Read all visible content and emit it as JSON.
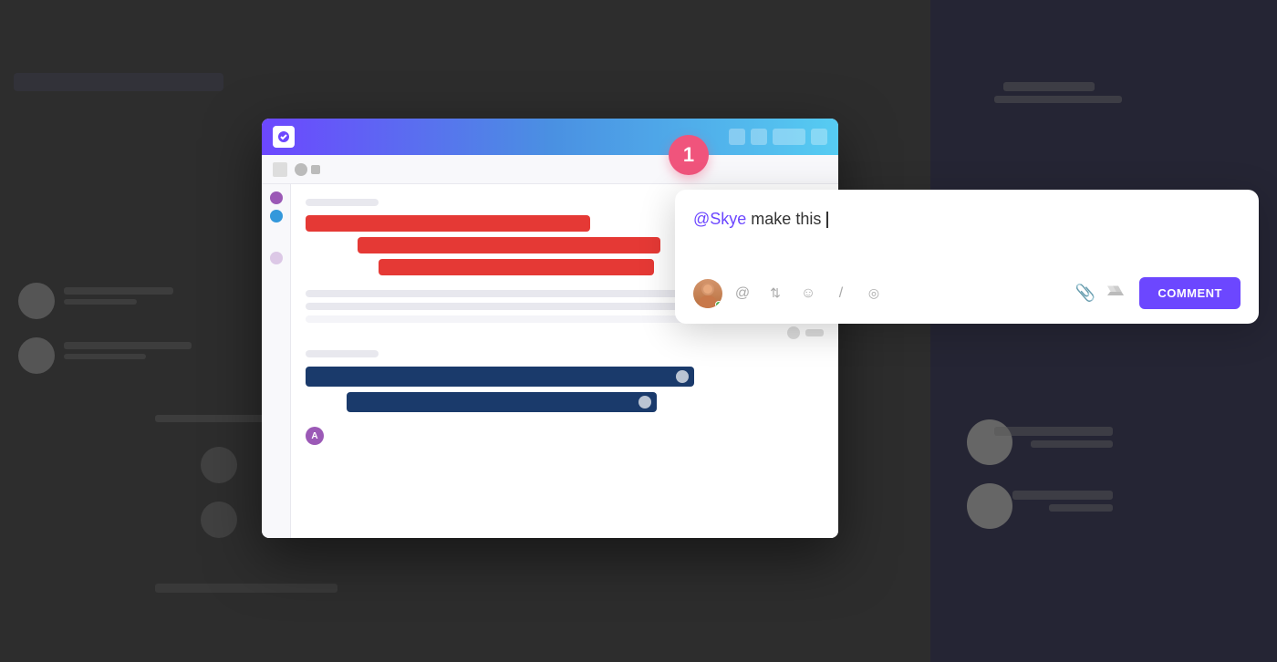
{
  "background": {
    "color": "#2d2d2d"
  },
  "badge": {
    "number": "1",
    "color": "#f0547c"
  },
  "comment_popup": {
    "mention": "@Skye",
    "text": " make this ",
    "cursor": true,
    "toolbar": {
      "mention_icon": "@",
      "assign_icon": "⇅",
      "emoji_icon": "☺",
      "slash_icon": "/",
      "target_icon": "◎",
      "attachment_icon": "📎",
      "drive_icon": "▲",
      "submit_label": "COMMENT"
    },
    "colors": {
      "mention": "#6c47ff",
      "submit_bg": "#6c47ff",
      "submit_text": "#ffffff"
    }
  },
  "screenshot": {
    "header": {
      "gradient_start": "#6c47ff",
      "gradient_end": "#56ccf2"
    },
    "gantt": {
      "red_bars": [
        {
          "width": "55%",
          "indent": "10%"
        },
        {
          "width": "65%",
          "indent": "15%"
        },
        {
          "width": "55%",
          "indent": "18%"
        }
      ],
      "blue_bars": [
        {
          "width": "70%",
          "indent": "5%"
        },
        {
          "width": "60%",
          "indent": "12%"
        }
      ]
    }
  }
}
